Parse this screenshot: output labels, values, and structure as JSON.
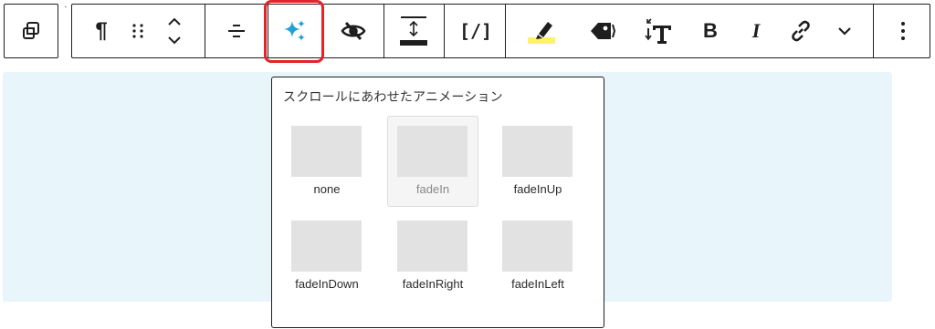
{
  "toolbar": {
    "buttons": [
      {
        "name": "transform-block-button",
        "icon": "duplicate-squares-icon"
      },
      {
        "name": "paragraph-button",
        "icon": "pilcrow-icon",
        "text": "¶"
      },
      {
        "name": "drag-handle",
        "icon": "drag-dots-icon"
      },
      {
        "name": "move-up-down-buttons",
        "icon": "chevron-up-down-icon"
      },
      {
        "name": "align-button",
        "icon": "align-center-lines-icon"
      },
      {
        "name": "animation-button",
        "icon": "sparkles-icon"
      },
      {
        "name": "hide-button",
        "icon": "eye-slash-icon"
      },
      {
        "name": "spacing-button",
        "icon": "vertical-spacing-icon"
      },
      {
        "name": "shortcode-button",
        "icon": "bracket-slash-icon",
        "text": "[/]"
      },
      {
        "name": "highlight-button",
        "icon": "marker-icon"
      },
      {
        "name": "tag-button",
        "icon": "tag-icon"
      },
      {
        "name": "font-size-button",
        "icon": "text-size-icon"
      },
      {
        "name": "bold-button",
        "icon": "bold-icon",
        "text": "B"
      },
      {
        "name": "italic-button",
        "icon": "italic-icon",
        "text": "I"
      },
      {
        "name": "link-button",
        "icon": "link-icon"
      },
      {
        "name": "more-format-button",
        "icon": "chevron-down-icon"
      },
      {
        "name": "options-button",
        "icon": "vertical-ellipsis-icon",
        "text": "⋮"
      }
    ],
    "colors": {
      "accent": "#1ea0d8",
      "highlight_outline": "#e3242b",
      "marker": "#fff266"
    }
  },
  "popover": {
    "title": "スクロールにあわせたアニメーション",
    "options": [
      {
        "label": "none",
        "selected": false
      },
      {
        "label": "fadeIn",
        "selected": true
      },
      {
        "label": "fadeInUp",
        "selected": false
      },
      {
        "label": "fadeInDown",
        "selected": false
      },
      {
        "label": "fadeInRight",
        "selected": false
      },
      {
        "label": "fadeInLeft",
        "selected": false
      }
    ]
  }
}
